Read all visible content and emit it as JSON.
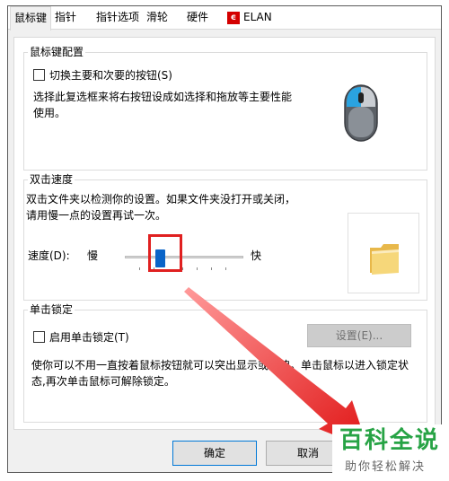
{
  "tabs": [
    {
      "label": "鼠标键"
    },
    {
      "label": "指针"
    },
    {
      "label": "指针选项"
    },
    {
      "label": "滑轮"
    },
    {
      "label": "硬件"
    },
    {
      "label": "ELAN",
      "icon": "elan-logo-icon"
    }
  ],
  "button_config": {
    "title": "鼠标键配置",
    "checkbox_label": "切换主要和次要的按钮(S)",
    "checked": false,
    "description": "选择此复选框来将右按钮设成如选择和拖放等主要性能使用。"
  },
  "double_click": {
    "title": "双击速度",
    "description": "双击文件夹以检测你的设置。如果文件夹没打开或关闭，请用慢一点的设置再试一次。",
    "speed_label": "速度(D):",
    "slow_label": "慢",
    "fast_label": "快",
    "speed_level": 0.3
  },
  "click_lock": {
    "title": "单击锁定",
    "checkbox_label": "启用单击锁定(T)",
    "checked": false,
    "settings_button": "设置(E)...",
    "description": "使你可以不用一直按着鼠标按钮就可以突出显示或拖拽。单击鼠标以进入锁定状态,再次单击鼠标可解除锁定。"
  },
  "footer": {
    "ok_label": "确定",
    "cancel_label": "取消"
  },
  "watermark": {
    "title": "百科全说",
    "subtitle": "助你轻松解决"
  },
  "colors": {
    "accent": "#0a64c8",
    "highlight": "#e02020",
    "watermark_green": "#27a345"
  }
}
